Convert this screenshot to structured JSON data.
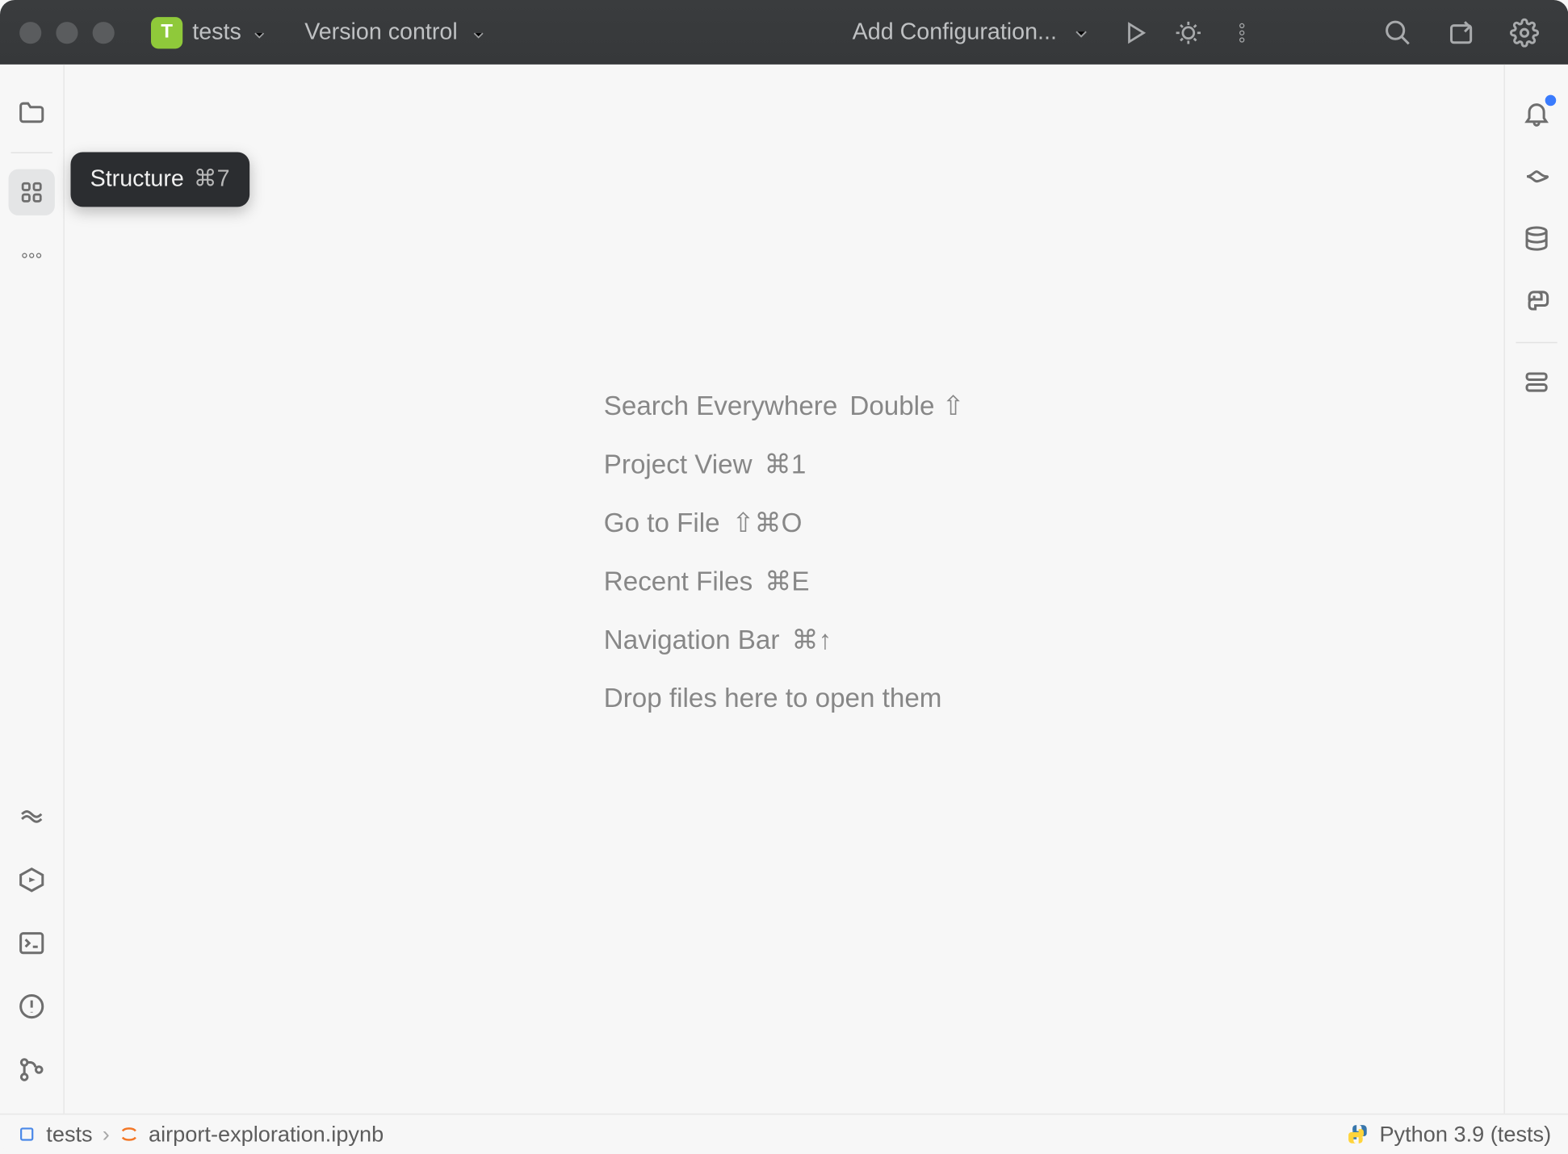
{
  "titlebar": {
    "project_letter": "T",
    "project_name": "tests",
    "version_control": "Version control",
    "run_config": "Add Configuration..."
  },
  "tooltip": {
    "label": "Structure",
    "shortcut": "⌘7"
  },
  "empty_guide": {
    "items": [
      {
        "label": "Search Everywhere",
        "shortcut": "Double ⇧"
      },
      {
        "label": "Project View",
        "shortcut": "⌘1"
      },
      {
        "label": "Go to File",
        "shortcut": "⇧⌘O"
      },
      {
        "label": "Recent Files",
        "shortcut": "⌘E"
      },
      {
        "label": "Navigation Bar",
        "shortcut": "⌘↑"
      }
    ],
    "drop_hint": "Drop files here to open them"
  },
  "statusbar": {
    "breadcrumb_root": "tests",
    "breadcrumb_file": "airport-exploration.ipynb",
    "interpreter": "Python 3.9 (tests)"
  }
}
